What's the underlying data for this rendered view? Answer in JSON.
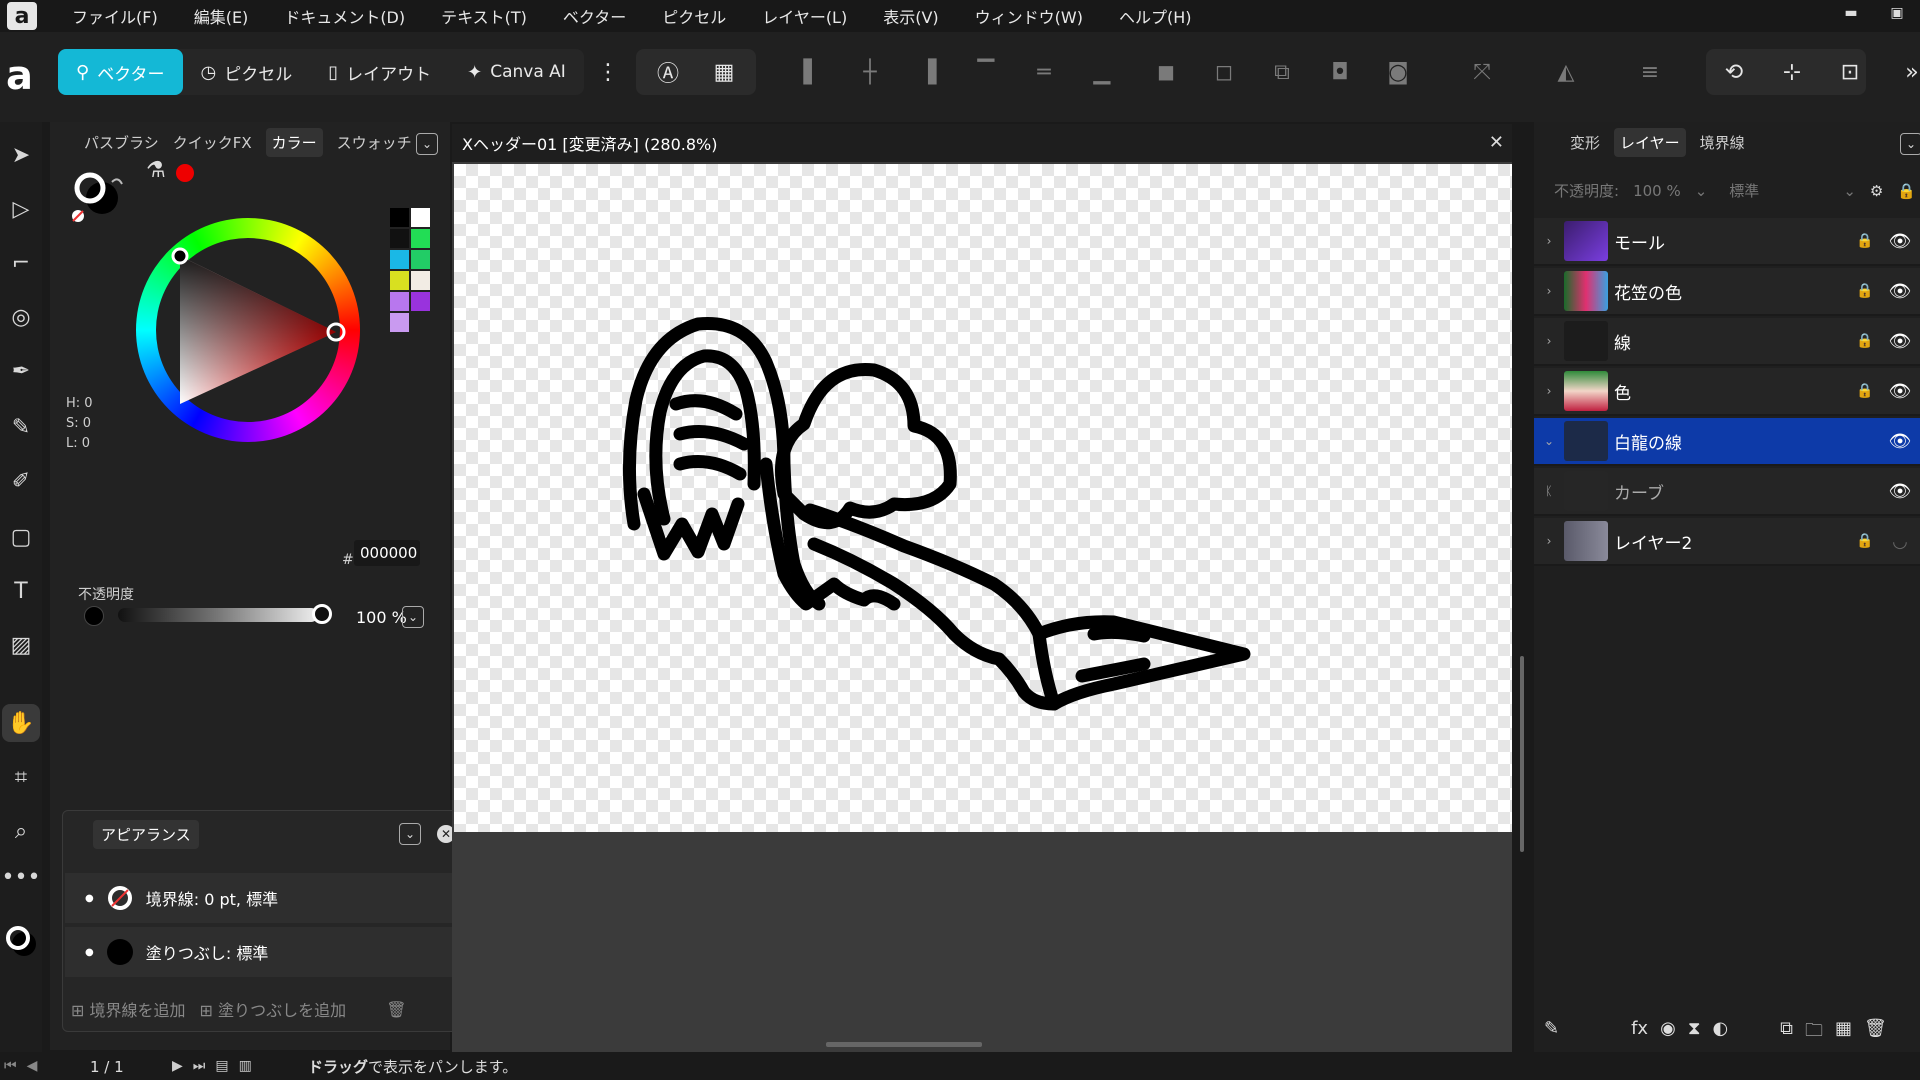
{
  "menubar": {
    "items": [
      "ファイル(F)",
      "編集(E)",
      "ドキュメント(D)",
      "テキスト(T)",
      "ベクター",
      "ピクセル",
      "レイヤー(L)",
      "表示(V)",
      "ウィンドウ(W)",
      "ヘルプ(H)"
    ],
    "window_controls": [
      "minimize",
      "maximize"
    ]
  },
  "toolbar": {
    "personas": [
      {
        "label": "ベクター",
        "icon": "vector-persona-icon",
        "active": true
      },
      {
        "label": "ピクセル",
        "icon": "pixel-persona-icon",
        "active": false
      },
      {
        "label": "レイアウト",
        "icon": "layout-persona-icon",
        "active": false
      },
      {
        "label": "Canva AI",
        "icon": "sparkle-icon",
        "active": false
      }
    ]
  },
  "left_panel": {
    "tabs": [
      "パスブラシ",
      "クイックFX",
      "カラー",
      "スウォッチ"
    ],
    "active_tab": "カラー",
    "hsl": {
      "h": "H: 0",
      "s": "S: 0",
      "l": "L: 0"
    },
    "hex_label": "#:",
    "hex_value": "000000",
    "opacity_label": "不透明度",
    "opacity_value": "100 %",
    "swatches": [
      "#000000",
      "#ffffff",
      "#111111",
      "#22dd55",
      "#1ab8e6",
      "#22cc66",
      "#d8e020",
      "#f2ece4",
      "#b877ee",
      "#9933dd",
      "#c99af0"
    ]
  },
  "appearance": {
    "title": "アピアランス",
    "stroke_label": "境界線: 0 pt,  標準",
    "fill_label": "塗りつぶし:  標準",
    "add_stroke": "境界線を追加",
    "add_fill": "塗りつぶしを追加"
  },
  "document": {
    "title": "Xヘッダー01 [変更済み] (280.8%)"
  },
  "right_panel": {
    "tabs": [
      "変形",
      "レイヤー",
      "境界線"
    ],
    "active_tab": "レイヤー",
    "opacity_label": "不透明度:",
    "opacity_value": "100 %",
    "blend_mode": "標準",
    "layers": [
      {
        "name": "モール",
        "locked": true,
        "visible": true,
        "selected": false
      },
      {
        "name": "花笠の色",
        "locked": true,
        "visible": true,
        "selected": false
      },
      {
        "name": "線",
        "locked": true,
        "visible": true,
        "selected": false
      },
      {
        "name": "色",
        "locked": true,
        "visible": true,
        "selected": false
      },
      {
        "name": "白龍の線",
        "locked": false,
        "visible": true,
        "selected": true
      },
      {
        "name": "カーブ",
        "locked": false,
        "visible": true,
        "selected": false
      },
      {
        "name": "レイヤー2",
        "locked": true,
        "visible": false,
        "selected": false
      }
    ]
  },
  "statusbar": {
    "page": "1 / 1",
    "message_bold": "ドラッグ",
    "message": "で表示をパンします。"
  },
  "colors": {
    "accent": "#14b8d6",
    "selection": "#0d3aa8",
    "panel": "#222222"
  }
}
